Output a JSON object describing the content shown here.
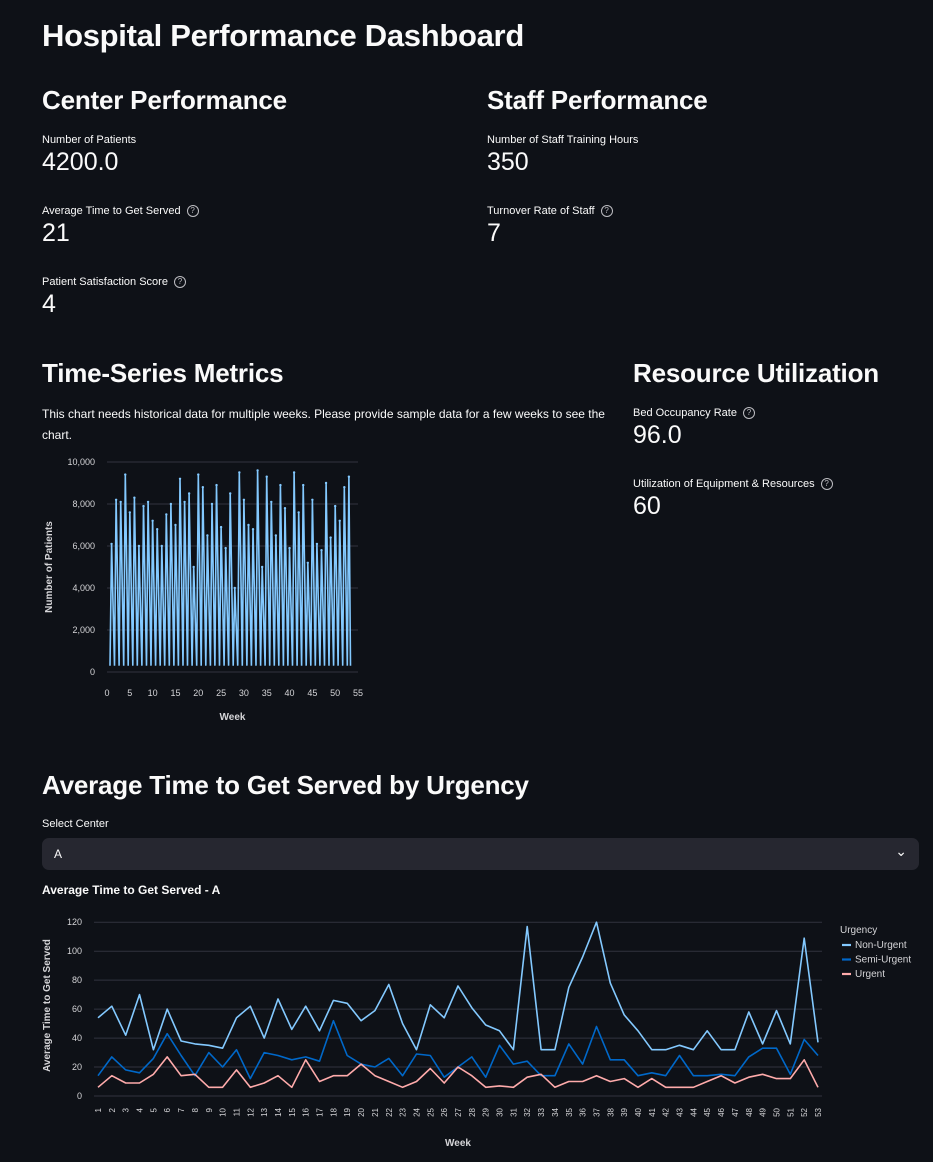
{
  "page": {
    "title": "Hospital Performance Dashboard"
  },
  "center_performance": {
    "heading": "Center Performance",
    "metrics": [
      {
        "label": "Number of Patients",
        "value": "4200.0",
        "help": false
      },
      {
        "label": "Average Time to Get Served",
        "value": "21",
        "help": true
      },
      {
        "label": "Patient Satisfaction Score",
        "value": "4",
        "help": true
      }
    ]
  },
  "staff_performance": {
    "heading": "Staff Performance",
    "metrics": [
      {
        "label": "Number of Staff Training Hours",
        "value": "350",
        "help": false
      },
      {
        "label": "Turnover Rate of Staff",
        "value": "7",
        "help": true
      }
    ]
  },
  "time_series": {
    "heading": "Time-Series Metrics",
    "note": "This chart needs historical data for multiple weeks. Please provide sample data for a few weeks to see the chart."
  },
  "resource_utilization": {
    "heading": "Resource Utilization",
    "metrics": [
      {
        "label": "Bed Occupancy Rate",
        "value": "96.0",
        "help": true
      },
      {
        "label": "Utilization of Equipment & Resources",
        "value": "60",
        "help": true
      }
    ]
  },
  "urgency_section": {
    "heading": "Average Time to Get Served by Urgency",
    "select_label": "Select Center",
    "select_value": "A",
    "chart_title": "Average Time to Get Served - A"
  },
  "help_glyph": "?",
  "chevron_glyph": "⌄",
  "colors": {
    "non_urgent": "#83c9ff",
    "semi_urgent": "#0068c9",
    "urgent": "#ffabab",
    "background": "#0e1117"
  },
  "chart_data": [
    {
      "type": "line",
      "xlabel": "Week",
      "ylabel": "Number of Patients",
      "xlim": [
        0,
        55
      ],
      "ylim": [
        0,
        10000
      ],
      "xticks": [
        0,
        5,
        10,
        15,
        20,
        25,
        30,
        35,
        40,
        45,
        50,
        55
      ],
      "ytick_labels": [
        "0",
        "2,000",
        "4,000",
        "6,000",
        "8,000",
        "10,000"
      ],
      "yticks": [
        0,
        2000,
        4000,
        6000,
        8000,
        10000
      ],
      "peaks": [
        {
          "x": 1,
          "y": 6100
        },
        {
          "x": 2,
          "y": 8200
        },
        {
          "x": 3,
          "y": 8100
        },
        {
          "x": 4,
          "y": 9400
        },
        {
          "x": 5,
          "y": 7600
        },
        {
          "x": 6,
          "y": 8300
        },
        {
          "x": 7,
          "y": 6000
        },
        {
          "x": 8,
          "y": 7900
        },
        {
          "x": 9,
          "y": 8100
        },
        {
          "x": 10,
          "y": 7200
        },
        {
          "x": 11,
          "y": 6800
        },
        {
          "x": 12,
          "y": 6000
        },
        {
          "x": 13,
          "y": 7500
        },
        {
          "x": 14,
          "y": 8000
        },
        {
          "x": 15,
          "y": 7000
        },
        {
          "x": 16,
          "y": 9200
        },
        {
          "x": 17,
          "y": 8100
        },
        {
          "x": 18,
          "y": 8500
        },
        {
          "x": 19,
          "y": 5000
        },
        {
          "x": 20,
          "y": 9400
        },
        {
          "x": 21,
          "y": 8800
        },
        {
          "x": 22,
          "y": 6500
        },
        {
          "x": 23,
          "y": 8000
        },
        {
          "x": 24,
          "y": 8900
        },
        {
          "x": 25,
          "y": 6900
        },
        {
          "x": 26,
          "y": 5900
        },
        {
          "x": 27,
          "y": 8500
        },
        {
          "x": 28,
          "y": 4000
        },
        {
          "x": 29,
          "y": 9500
        },
        {
          "x": 30,
          "y": 8200
        },
        {
          "x": 31,
          "y": 7000
        },
        {
          "x": 32,
          "y": 6800
        },
        {
          "x": 33,
          "y": 9600
        },
        {
          "x": 34,
          "y": 5000
        },
        {
          "x": 35,
          "y": 9300
        },
        {
          "x": 36,
          "y": 8100
        },
        {
          "x": 37,
          "y": 6500
        },
        {
          "x": 38,
          "y": 8900
        },
        {
          "x": 39,
          "y": 7800
        },
        {
          "x": 40,
          "y": 5900
        },
        {
          "x": 41,
          "y": 9500
        },
        {
          "x": 42,
          "y": 7600
        },
        {
          "x": 43,
          "y": 8900
        },
        {
          "x": 44,
          "y": 5200
        },
        {
          "x": 45,
          "y": 8200
        },
        {
          "x": 46,
          "y": 6100
        },
        {
          "x": 47,
          "y": 5800
        },
        {
          "x": 48,
          "y": 9000
        },
        {
          "x": 49,
          "y": 6400
        },
        {
          "x": 50,
          "y": 7900
        },
        {
          "x": 51,
          "y": 7200
        },
        {
          "x": 52,
          "y": 8800
        },
        {
          "x": 53,
          "y": 9300
        }
      ],
      "trough": 300
    },
    {
      "type": "line",
      "title": "Average Time to Get Served - A",
      "xlabel": "Week",
      "ylabel": "Average Time to Get Served",
      "legend_title": "Urgency",
      "legend_position": "right",
      "ylim": [
        0,
        125
      ],
      "yticks": [
        0,
        20,
        40,
        60,
        80,
        100,
        120
      ],
      "x": [
        1,
        2,
        3,
        4,
        5,
        6,
        7,
        8,
        9,
        10,
        11,
        12,
        13,
        14,
        15,
        16,
        17,
        18,
        19,
        20,
        21,
        22,
        23,
        24,
        25,
        26,
        27,
        28,
        29,
        30,
        31,
        32,
        33,
        34,
        35,
        36,
        37,
        38,
        39,
        40,
        41,
        42,
        43,
        44,
        45,
        46,
        47,
        48,
        49,
        50,
        51,
        52,
        53
      ],
      "series": [
        {
          "name": "Non-Urgent",
          "color": "#83c9ff",
          "values": [
            54,
            62,
            42,
            70,
            32,
            60,
            38,
            36,
            35,
            33,
            54,
            62,
            40,
            67,
            46,
            62,
            45,
            66,
            64,
            52,
            59,
            77,
            50,
            32,
            63,
            54,
            76,
            61,
            49,
            45,
            32,
            117,
            32,
            32,
            75,
            96,
            120,
            78,
            56,
            45,
            32,
            32,
            35,
            32,
            45,
            32,
            32,
            58,
            36,
            59,
            36,
            109,
            37
          ]
        },
        {
          "name": "Semi-Urgent",
          "color": "#0068c9",
          "values": [
            14,
            27,
            18,
            16,
            26,
            43,
            28,
            14,
            30,
            20,
            32,
            12,
            30,
            28,
            25,
            27,
            24,
            52,
            28,
            22,
            20,
            26,
            14,
            29,
            28,
            13,
            20,
            27,
            13,
            35,
            22,
            24,
            14,
            14,
            36,
            22,
            48,
            25,
            25,
            14,
            16,
            14,
            28,
            14,
            14,
            15,
            14,
            27,
            33,
            33,
            15,
            39,
            28
          ]
        },
        {
          "name": "Urgent",
          "color": "#ffabab",
          "values": [
            6,
            14,
            9,
            9,
            15,
            27,
            14,
            15,
            6,
            6,
            18,
            6,
            9,
            14,
            6,
            25,
            10,
            14,
            14,
            22,
            14,
            10,
            6,
            10,
            19,
            9,
            20,
            14,
            6,
            7,
            6,
            13,
            15,
            6,
            10,
            10,
            14,
            10,
            12,
            6,
            12,
            6,
            6,
            6,
            10,
            14,
            9,
            13,
            15,
            12,
            12,
            25,
            6
          ]
        }
      ]
    }
  ]
}
